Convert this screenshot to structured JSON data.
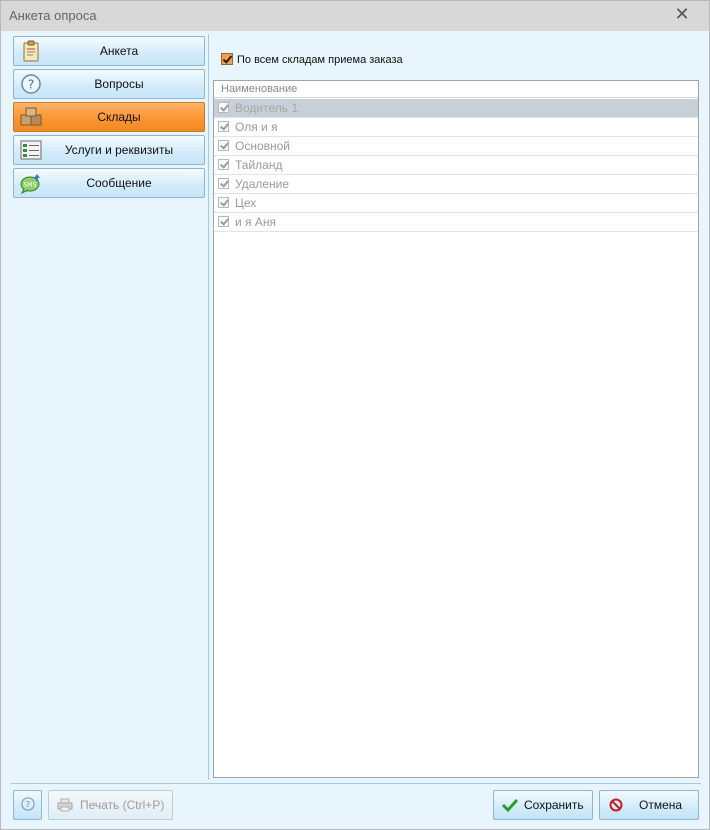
{
  "window": {
    "title": "Анкета опроса"
  },
  "nav": {
    "items": [
      {
        "label": "Анкета",
        "icon": "clipboard-icon",
        "active": false
      },
      {
        "label": "Вопросы",
        "icon": "question-icon",
        "active": false
      },
      {
        "label": "Склады",
        "icon": "boxes-icon",
        "active": true
      },
      {
        "label": "Услуги и реквизиты",
        "icon": "list-form-icon",
        "active": false
      },
      {
        "label": "Сообщение",
        "icon": "sms-icon",
        "active": false
      }
    ]
  },
  "main": {
    "all_warehouses_label": "По всем складам приема заказа",
    "all_warehouses_checked": true,
    "grid": {
      "column_header": "Наименование",
      "rows": [
        {
          "name": "Водитель 1",
          "checked": true,
          "selected": true
        },
        {
          "name": "Оля и я",
          "checked": true,
          "selected": false
        },
        {
          "name": "Основной",
          "checked": true,
          "selected": false
        },
        {
          "name": "Тайланд",
          "checked": true,
          "selected": false
        },
        {
          "name": "Удаление",
          "checked": true,
          "selected": false
        },
        {
          "name": "Цех",
          "checked": true,
          "selected": false
        },
        {
          "name": "и я Аня",
          "checked": true,
          "selected": false
        }
      ]
    }
  },
  "footer": {
    "print_label": "Печать (Ctrl+P)",
    "save_label": "Сохранить",
    "cancel_label": "Отмена"
  },
  "colors": {
    "active_nav": "#fb9532",
    "save_check": "#2e9a2e",
    "cancel_icon": "#c0202a"
  }
}
